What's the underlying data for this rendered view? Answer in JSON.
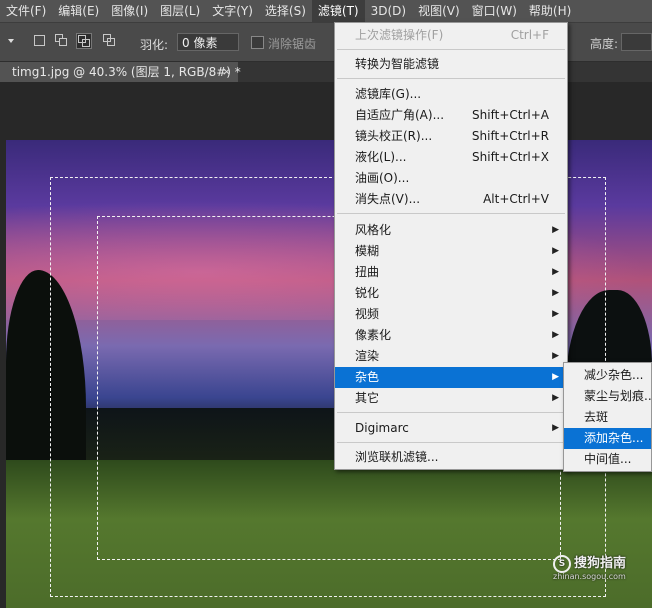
{
  "menubar": {
    "items": [
      {
        "label": "文件(F)"
      },
      {
        "label": "编辑(E)"
      },
      {
        "label": "图像(I)"
      },
      {
        "label": "图层(L)"
      },
      {
        "label": "文字(Y)"
      },
      {
        "label": "选择(S)"
      },
      {
        "label": "滤镜(T)"
      },
      {
        "label": "3D(D)"
      },
      {
        "label": "视图(V)"
      },
      {
        "label": "窗口(W)"
      },
      {
        "label": "帮助(H)"
      }
    ],
    "active_index": 6
  },
  "options_bar": {
    "feather_label": "羽化:",
    "feather_value": "0 像素",
    "antialias_label": "消除锯齿",
    "height_label": "高度:"
  },
  "document_tab": {
    "title": "timg1.jpg @ 40.3% (图层 1, RGB/8#) *",
    "close": "×"
  },
  "filter_menu": {
    "last_filter": {
      "label": "上次滤镜操作(F)",
      "shortcut": "Ctrl+F"
    },
    "convert_smart": {
      "label": "转换为智能滤镜"
    },
    "gallery": {
      "label": "滤镜库(G)..."
    },
    "adaptive_wide": {
      "label": "自适应广角(A)...",
      "shortcut": "Shift+Ctrl+A"
    },
    "lens_correction": {
      "label": "镜头校正(R)...",
      "shortcut": "Shift+Ctrl+R"
    },
    "liquify": {
      "label": "液化(L)...",
      "shortcut": "Shift+Ctrl+X"
    },
    "oil_paint": {
      "label": "油画(O)..."
    },
    "vanishing_point": {
      "label": "消失点(V)...",
      "shortcut": "Alt+Ctrl+V"
    },
    "stylize": {
      "label": "风格化"
    },
    "blur": {
      "label": "模糊"
    },
    "distort": {
      "label": "扭曲"
    },
    "sharpen": {
      "label": "锐化"
    },
    "video": {
      "label": "视频"
    },
    "pixelate": {
      "label": "像素化"
    },
    "render": {
      "label": "渲染"
    },
    "noise": {
      "label": "杂色"
    },
    "other": {
      "label": "其它"
    },
    "digimarc": {
      "label": "Digimarc"
    },
    "browse_online": {
      "label": "浏览联机滤镜..."
    }
  },
  "noise_submenu": {
    "reduce_noise": {
      "label": "减少杂色..."
    },
    "dust_scratches": {
      "label": "蒙尘与划痕..."
    },
    "despeckle": {
      "label": "去斑"
    },
    "add_noise": {
      "label": "添加杂色..."
    },
    "median": {
      "label": "中间值..."
    }
  },
  "watermark": {
    "text": "搜狗指南",
    "sub": "zhinan.sogou.com",
    "logo_char": "S"
  }
}
